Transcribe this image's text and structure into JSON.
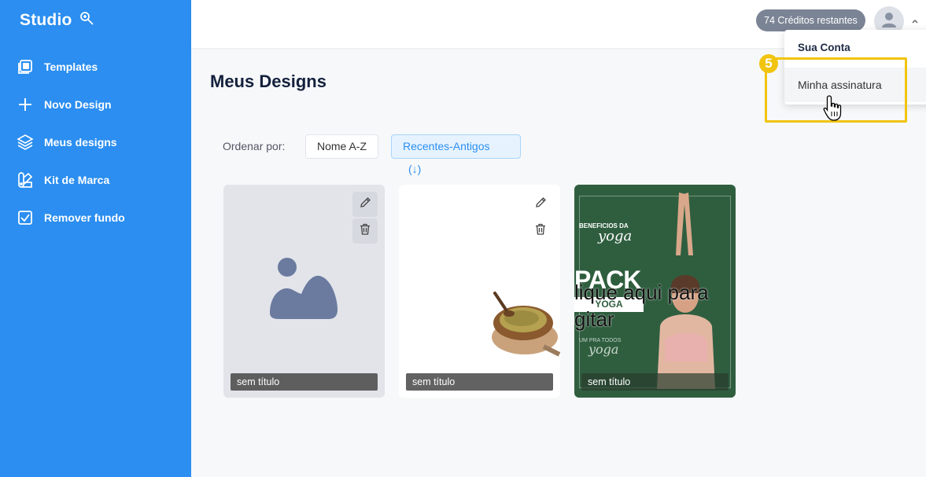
{
  "app": {
    "name": "Studio"
  },
  "sidebar": {
    "items": [
      {
        "label": "Templates",
        "icon": "templates-icon"
      },
      {
        "label": "Novo Design",
        "icon": "plus-icon"
      },
      {
        "label": "Meus designs",
        "icon": "layers-icon"
      },
      {
        "label": "Kit de Marca",
        "icon": "brand-kit-icon"
      },
      {
        "label": "Remover fundo",
        "icon": "remove-background-icon"
      }
    ]
  },
  "header": {
    "credits": "74 Créditos restantes",
    "avatar_icon": "user-icon"
  },
  "account_menu": {
    "header": "Sua Conta",
    "items": [
      {
        "label": "Minha assinatura"
      }
    ]
  },
  "tutorial": {
    "step": "5",
    "highlight_color": "#f1c40f"
  },
  "main": {
    "title": "Meus Designs",
    "sort": {
      "label": "Ordenar por:",
      "options": [
        {
          "label": "Nome A-Z",
          "active": false
        },
        {
          "label": "Recentes-Antigos",
          "arrow": "(↓)",
          "active": true
        }
      ]
    },
    "designs": [
      {
        "caption": "sem título",
        "thumbnail": "placeholder-image"
      },
      {
        "caption": "sem título",
        "thumbnail": "spice-bowl-image"
      },
      {
        "caption": "sem título",
        "thumbnail": "yoga-pack-image",
        "art": {
          "heading": "BENEFICIOS DA",
          "script": "yoga",
          "pack": "PACK",
          "band": "YOGA",
          "overlay": "lique aqui para\ngitar",
          "small": "UM PRA TODOS",
          "script2": "yoga"
        }
      }
    ]
  },
  "colors": {
    "sidebar": "#2b8ef0",
    "accent": "#2b8ef0",
    "credits_badge": "#7b8495",
    "title": "#14213d"
  }
}
